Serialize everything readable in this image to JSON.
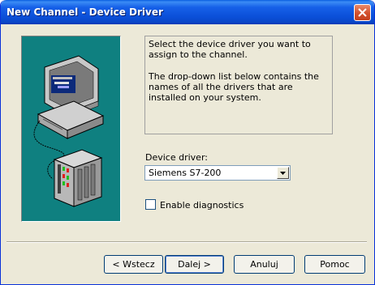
{
  "window": {
    "title": "New Channel - Device Driver"
  },
  "info": {
    "line1": "Select the device driver you want to assign to the channel.",
    "line2": "The drop-down list below contains the names of all the drivers that are installed on your system."
  },
  "driver": {
    "label": "Device driver:",
    "selected": "Siemens S7-200"
  },
  "diagnostics": {
    "label": "Enable diagnostics",
    "checked": false
  },
  "buttons": {
    "back": "< Wstecz",
    "next": "Dalej >",
    "cancel": "Anuluj",
    "help": "Pomoc"
  }
}
